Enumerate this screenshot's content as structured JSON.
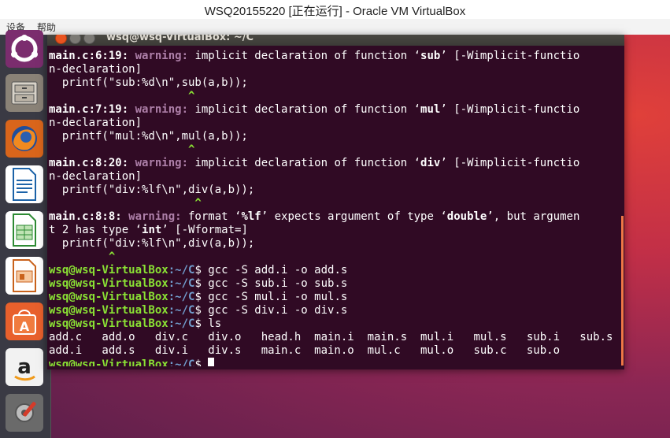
{
  "window": {
    "title": "WSQ20155220 [正在运行] - Oracle VM VirtualBox"
  },
  "menubar": {
    "items": [
      "设备",
      "帮助"
    ]
  },
  "launcher": {
    "icons": [
      "ubuntu-icon",
      "files-icon",
      "firefox-icon",
      "writer-icon",
      "calc-icon",
      "impress-icon",
      "software-center-icon",
      "amazon-icon",
      "settings-icon"
    ]
  },
  "terminal": {
    "title": "wsq@wsq-VirtualBox: ~/C",
    "prompt_user": "wsq@wsq-VirtualBox",
    "prompt_path": ":~/C",
    "prompt_symbol": "$ ",
    "warn1": {
      "loc": "main.c:6:19:",
      "label": " warning:",
      "pre": " implicit declaration of function ",
      "q_open": "‘",
      "name": "sub",
      "q_close": "’",
      "post": " [-Wimplicit-functio",
      "cont": "n-declaration]",
      "code": "  printf(\"sub:%d\\n\",sub(a,b));",
      "caret": "                     ^"
    },
    "warn2": {
      "loc": "main.c:7:19:",
      "label": " warning:",
      "pre": " implicit declaration of function ",
      "q_open": "‘",
      "name": "mul",
      "q_close": "’",
      "post": " [-Wimplicit-functio",
      "cont": "n-declaration]",
      "code": "  printf(\"mul:%d\\n\",mul(a,b));",
      "caret": "                     ^"
    },
    "warn3": {
      "loc": "main.c:8:20:",
      "label": " warning:",
      "pre": " implicit declaration of function ",
      "q_open": "‘",
      "name": "div",
      "q_close": "’",
      "post": " [-Wimplicit-functio",
      "cont": "n-declaration]",
      "code": "  printf(\"div:%lf\\n\",div(a,b));",
      "caret": "                      ^"
    },
    "warn4": {
      "loc": "main.c:8:8:",
      "label": " warning:",
      "pre": " format ",
      "q1": "‘",
      "fmt": "%lf",
      "q2": "’",
      "mid": " expects argument of type ",
      "q3": "‘",
      "type1": "double",
      "q4": "’",
      "post": ", but argumen",
      "cont_pre": "t 2 has type ",
      "q5": "‘",
      "type2": "int",
      "q6": "’",
      "cont_post": " [-Wformat=]",
      "code": "  printf(\"div:%lf\\n\",div(a,b));",
      "caret": "         ^"
    },
    "commands": [
      "gcc -S add.i -o add.s",
      "gcc -S sub.i -o sub.s",
      "gcc -S mul.i -o mul.s",
      "gcc -S div.i -o div.s",
      "ls"
    ],
    "ls_row1": "add.c   add.o   div.c   div.o   head.h  main.i  main.s  mul.i   mul.s   sub.i   sub.s",
    "ls_row2": "add.i   add.s   div.i   div.s   main.c  main.o  mul.c   mul.o   sub.c   sub.o"
  }
}
